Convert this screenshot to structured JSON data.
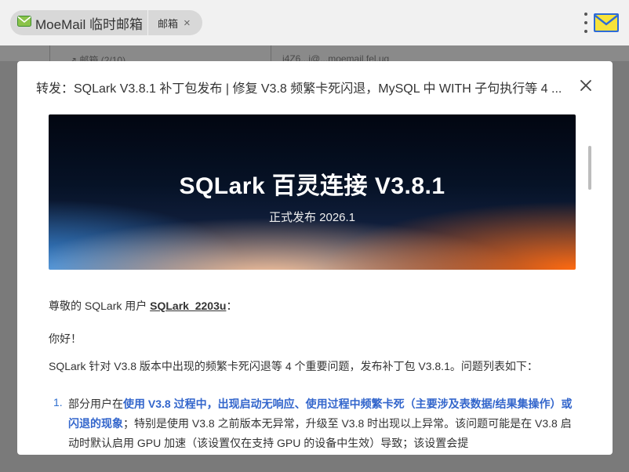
{
  "browser": {
    "tab_main_label": "MoeMail 临时邮箱",
    "tab_sub_label": "邮箱",
    "tab_sub_close": "×"
  },
  "background": {
    "left_text": "↗ 邮箱 (2/10)",
    "right_text": "j4Z6...i@...moemail.fel.ug"
  },
  "modal": {
    "title": "转发：SQLark V3.8.1 补丁包发布 | 修复 V3.8 频繁卡死闪退，MySQL 中 WITH 子句执行等 4 ...",
    "banner": {
      "title": "SQLark 百灵连接 V3.8.1",
      "subtitle": "正式发布 2026.1"
    },
    "greeting_prefix": "尊敬的 SQLark 用户 ",
    "greeting_user": "SQLark_2203u",
    "greeting_suffix": "：",
    "hello": "你好！",
    "intro": "SQLark 针对 V3.8 版本中出现的频繁卡死闪退等 4 个重要问题，发布补丁包 V3.8.1。问题列表如下：",
    "list_items": [
      {
        "num": "1.",
        "prefix": "部分用户在",
        "highlight": "使用 V3.8 过程中，出现启动无响应、使用过程中频繁卡死（主要涉及表数据/结果集操作）或闪退的现象",
        "rest": "；特别是使用 V3.8 之前版本无异常，升级至 V3.8 时出现以上异常。该问题可能是在 V3.8 启动时默认启用 GPU 加速（该设置仅在支持 GPU 的设备中生效）导致；该设置会提"
      }
    ]
  }
}
